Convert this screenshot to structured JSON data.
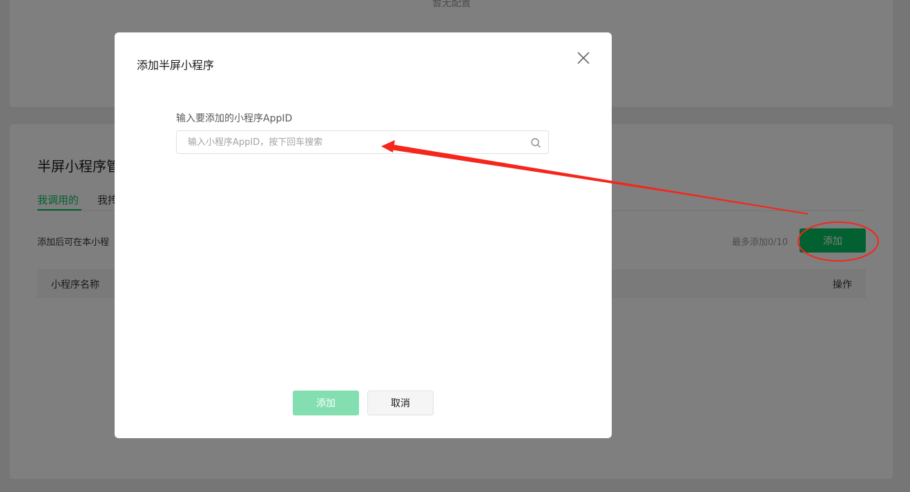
{
  "background": {
    "empty_config": "暂无配置",
    "section_title": "半屏小程序管",
    "tabs": [
      {
        "label": "我调用的",
        "active": true
      },
      {
        "label": "我抟",
        "active": false
      }
    ],
    "hint": "添加后可在本小程",
    "limit": "最多添加0/10",
    "add_button": "添加",
    "table": {
      "columns": [
        "小程序名称",
        "操作"
      ]
    }
  },
  "dialog": {
    "title": "添加半屏小程序",
    "field_label": "输入要添加的小程序AppID",
    "search_placeholder": "输入小程序AppID，按下回车搜索",
    "search_value": "",
    "add_button": "添加",
    "cancel_button": "取消",
    "close_icon": "close-icon",
    "search_icon": "search-icon"
  },
  "colors": {
    "brand_green": "#07c160",
    "disabled_green": "#83dfb0",
    "annotation_red": "#f5261c"
  }
}
